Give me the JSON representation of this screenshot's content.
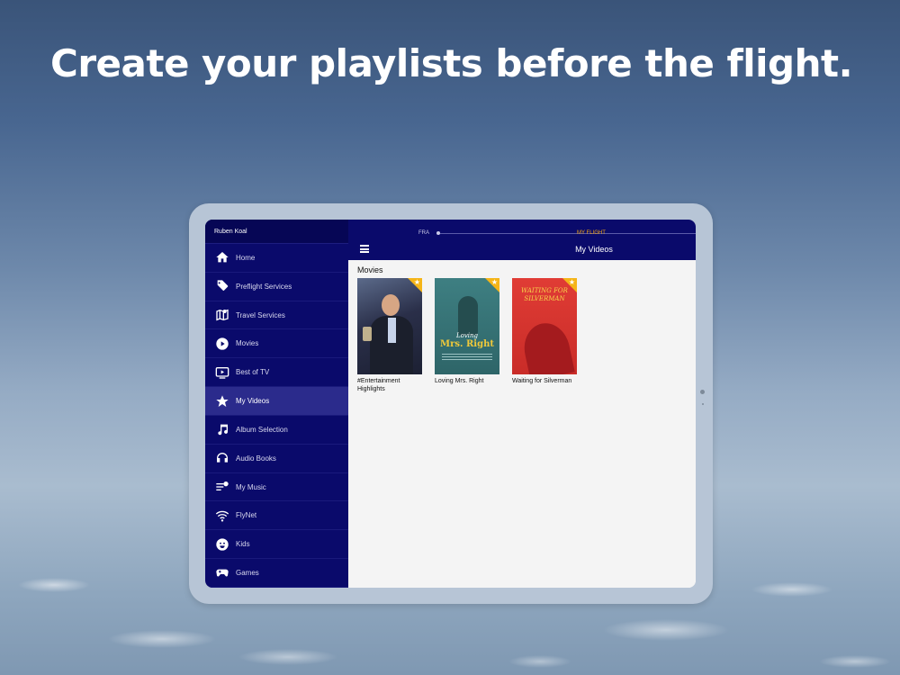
{
  "headline": "Create your playlists before the flight.",
  "user": {
    "name": "Ruben Koal"
  },
  "sidebar": {
    "items": [
      {
        "label": "Home",
        "icon": "home-icon",
        "active": false
      },
      {
        "label": "Preflight Services",
        "icon": "tag-icon",
        "active": false
      },
      {
        "label": "Travel Services",
        "icon": "map-pin-icon",
        "active": false
      },
      {
        "label": "Movies",
        "icon": "play-icon",
        "active": false
      },
      {
        "label": "Best of TV",
        "icon": "tv-icon",
        "active": false
      },
      {
        "label": "My Videos",
        "icon": "star-icon",
        "active": true
      },
      {
        "label": "Album Selection",
        "icon": "music-note-icon",
        "active": false
      },
      {
        "label": "Audio Books",
        "icon": "headphones-icon",
        "active": false
      },
      {
        "label": "My Music",
        "icon": "playlist-add-icon",
        "active": false
      },
      {
        "label": "FlyNet",
        "icon": "wifi-icon",
        "active": false
      },
      {
        "label": "Kids",
        "icon": "smiley-icon",
        "active": false
      },
      {
        "label": "Games",
        "icon": "gamepad-icon",
        "active": false
      }
    ]
  },
  "topbar": {
    "from": "FRA",
    "flight_label": "MY FLIGHT",
    "title": "My Videos"
  },
  "content": {
    "section_title": "Movies",
    "items": [
      {
        "title": "#Entertainment Highlights"
      },
      {
        "title": "Loving Mrs. Right",
        "poster_line1": "Loving",
        "poster_line2": "Mrs. Right"
      },
      {
        "title": "Waiting for Silverman",
        "poster_text": "WAITING FOR SILVERMAN"
      }
    ]
  },
  "colors": {
    "sidebar_bg": "#0a0a6b",
    "active_item": "#2b2b8c",
    "flight_accent": "#f3a712",
    "favorite_badge": "#f5b518"
  }
}
